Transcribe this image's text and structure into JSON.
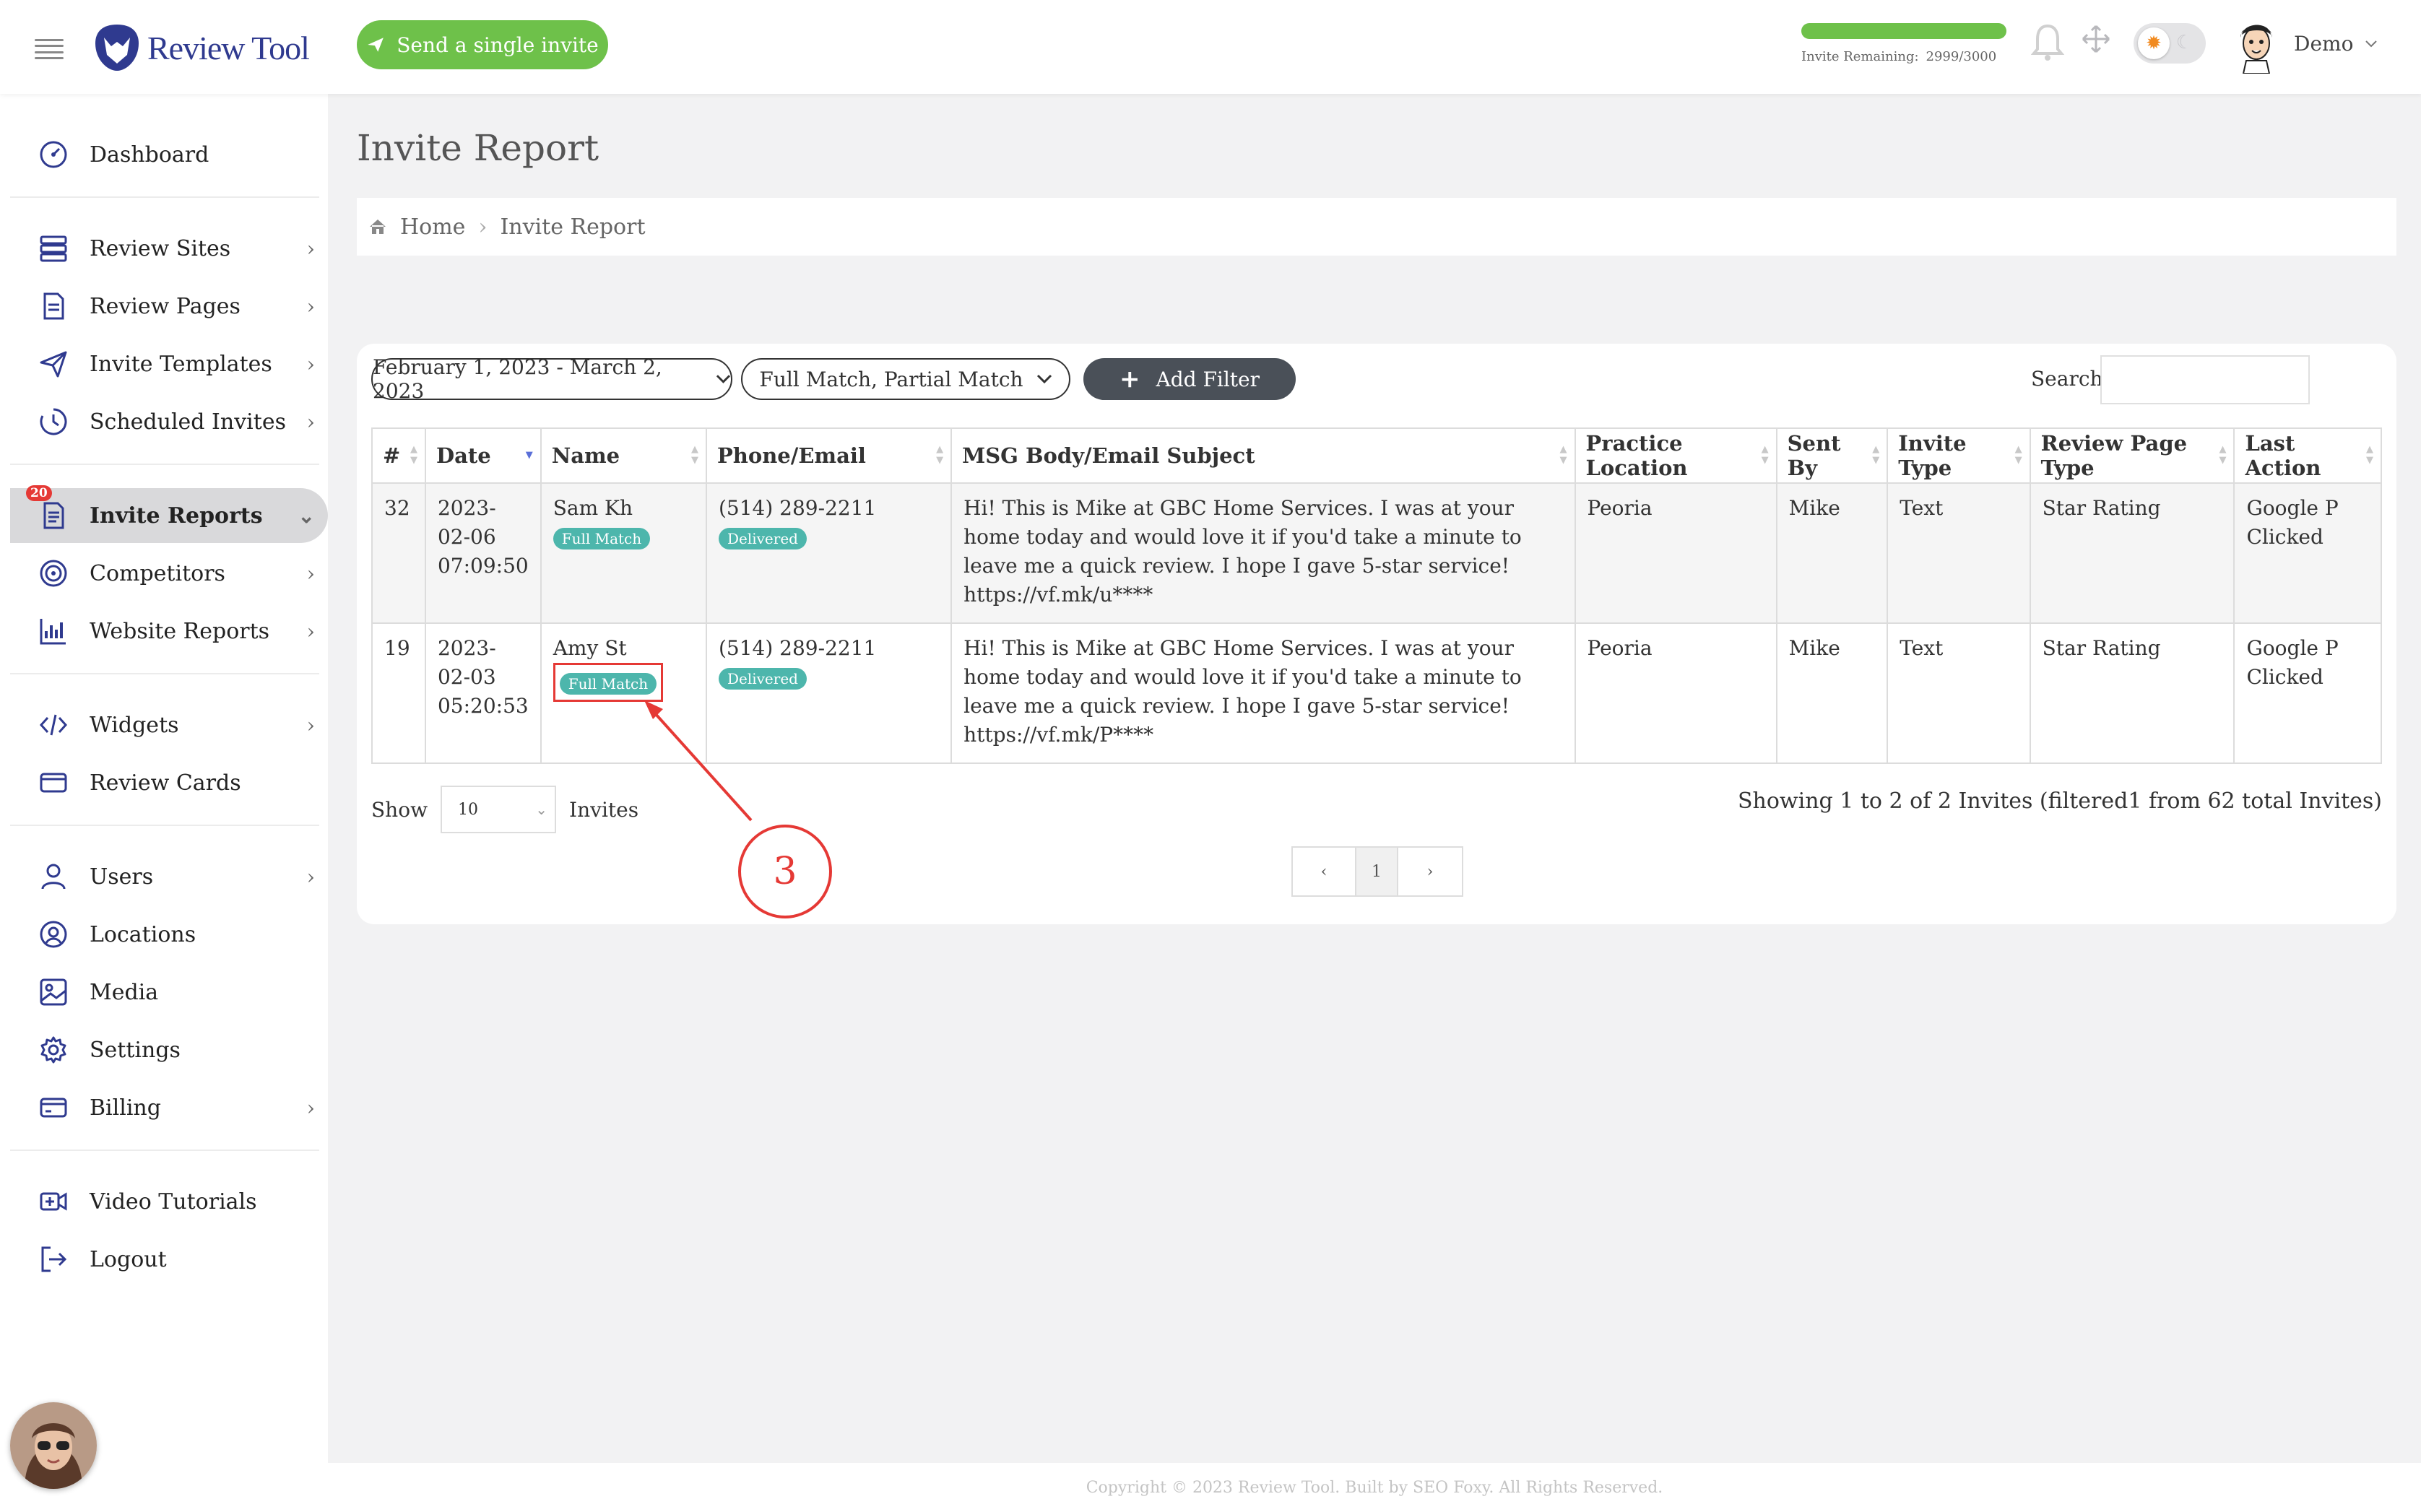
{
  "header": {
    "logo_text": "Review Tool",
    "send_invite_label": "Send a single invite",
    "invite_remaining_label": "Invite Remaining:",
    "invite_remaining_value": "2999/3000",
    "invite_remaining_fraction": 0.9997,
    "user_name": "Demo"
  },
  "sidebar": {
    "badge": "20",
    "items": [
      {
        "label": "Dashboard",
        "icon": "gauge-icon"
      },
      {
        "label": "Review Sites",
        "icon": "list-icon"
      },
      {
        "label": "Review Pages",
        "icon": "document-icon"
      },
      {
        "label": "Invite Templates",
        "icon": "paper-plane-icon"
      },
      {
        "label": "Scheduled Invites",
        "icon": "clock-icon"
      },
      {
        "label": "Invite Reports",
        "icon": "report-icon"
      },
      {
        "label": "Competitors",
        "icon": "target-icon"
      },
      {
        "label": "Website Reports",
        "icon": "bar-chart-icon"
      },
      {
        "label": "Widgets",
        "icon": "code-icon"
      },
      {
        "label": "Review Cards",
        "icon": "card-icon"
      },
      {
        "label": "Users",
        "icon": "user-icon"
      },
      {
        "label": "Locations",
        "icon": "location-icon"
      },
      {
        "label": "Media",
        "icon": "image-icon"
      },
      {
        "label": "Settings",
        "icon": "gear-icon"
      },
      {
        "label": "Billing",
        "icon": "credit-card-icon"
      },
      {
        "label": "Video Tutorials",
        "icon": "video-icon"
      },
      {
        "label": "Logout",
        "icon": "logout-icon"
      }
    ]
  },
  "page": {
    "title": "Invite Report",
    "breadcrumb": [
      "Home",
      "Invite Report"
    ]
  },
  "filters": {
    "date_range": "February 1, 2023 - March 2, 2023",
    "match": "Full Match, Partial Match",
    "add_filter": "Add Filter",
    "search_label": "Search:",
    "search_value": ""
  },
  "table": {
    "headers": [
      "#",
      "Date",
      "Name",
      "Phone/Email",
      "MSG Body/Email Subject",
      "Practice Location",
      "Sent By",
      "Invite Type",
      "Review Page Type",
      "Last Action"
    ],
    "rows": [
      {
        "num": "32",
        "date": "2023-02-06 07:09:50",
        "name": "Sam Kh",
        "name_tag": "Full Match",
        "phone": "(514) 289-2211",
        "phone_tag": "Delivered",
        "msg": "Hi! This is Mike at GBC Home Services. I was at your home today and would love it if you'd take a minute to leave me a quick review. I hope I gave 5-star service! https://vf.mk/u****",
        "location": "Peoria",
        "sent_by": "Mike",
        "invite_type": "Text",
        "review_page_type": "Star Rating",
        "last_action": "Google P Clicked"
      },
      {
        "num": "19",
        "date": "2023-02-03 05:20:53",
        "name": "Amy St",
        "name_tag": "Full Match",
        "phone": "(514) 289-2211",
        "phone_tag": "Delivered",
        "msg": "Hi! This is Mike at GBC Home Services. I was at your home today and would love it if you'd take a minute to leave me a quick review. I hope I gave 5-star service! https://vf.mk/P****",
        "location": "Peoria",
        "sent_by": "Mike",
        "invite_type": "Text",
        "review_page_type": "Star Rating",
        "last_action": "Google P Clicked"
      }
    ]
  },
  "pagination": {
    "show_label": "Show",
    "page_size": "10",
    "invites_label": "Invites",
    "summary": "Showing 1 to 2 of 2 Invites (filtered1 from 62 total Invites)",
    "current_page": "1"
  },
  "annotation": {
    "step": "3"
  },
  "footer": "Copyright © 2023 Review Tool. Built by SEO Foxy. All Rights Reserved."
}
